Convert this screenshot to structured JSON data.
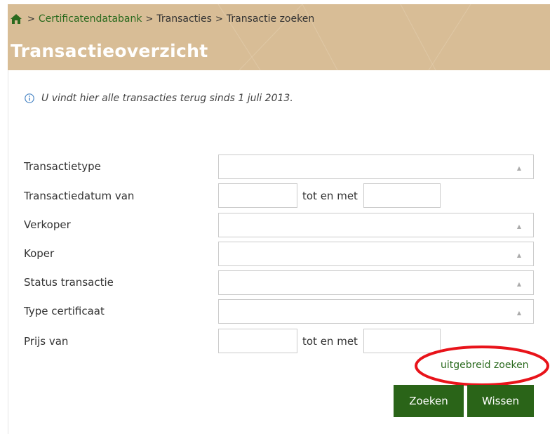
{
  "breadcrumb": {
    "items": [
      "Certificatendatabank",
      "Transacties",
      "Transactie zoeken"
    ],
    "separator": ">"
  },
  "page_title": "Transactieoverzicht",
  "info_text": "U vindt hier alle transacties terug sinds 1 juli 2013.",
  "form": {
    "transactietype_label": "Transactietype",
    "datum_van_label": "Transactiedatum van",
    "tot_en_met_label": "tot en met",
    "verkoper_label": "Verkoper",
    "koper_label": "Koper",
    "status_label": "Status transactie",
    "type_certificaat_label": "Type certificaat",
    "prijs_van_label": "Prijs van"
  },
  "advanced_search_link": "uitgebreid zoeken",
  "buttons": {
    "search": "Zoeken",
    "clear": "Wissen"
  },
  "colors": {
    "header_bg": "#d8bd96",
    "link_green": "#2a6a1e",
    "button_green": "#2a6418",
    "annotation_red": "#e8131a"
  },
  "icons": [
    "home-icon",
    "info-icon",
    "caret-up-icon"
  ]
}
